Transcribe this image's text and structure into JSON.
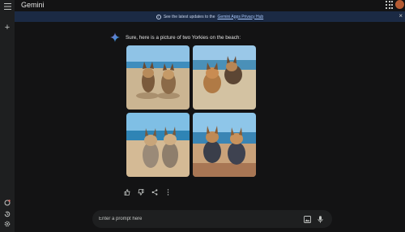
{
  "app": {
    "title": "Gemini"
  },
  "rail": {
    "icons": [
      "menu-icon",
      "new-chat-icon",
      "gem-icon",
      "history-icon",
      "settings-icon"
    ]
  },
  "banner": {
    "text_before": "See the latest updates to the",
    "link_text": "Gemini Apps Privacy Hub"
  },
  "response": {
    "text": "Sure, here is a picture of two Yorkies on the beach:"
  },
  "images": [
    {
      "name": "yorkies-beach-1"
    },
    {
      "name": "yorkies-beach-2"
    },
    {
      "name": "yorkies-beach-3"
    },
    {
      "name": "yorkies-beach-4"
    }
  ],
  "actions": [
    "thumbs-up-icon",
    "thumbs-down-icon",
    "share-icon",
    "more-options-icon"
  ],
  "prompt": {
    "placeholder": "Enter a prompt here"
  },
  "colors": {
    "background": "#131314",
    "banner": "#1b2a44",
    "link": "#a8c7fa",
    "accent": "#4c8df6"
  }
}
